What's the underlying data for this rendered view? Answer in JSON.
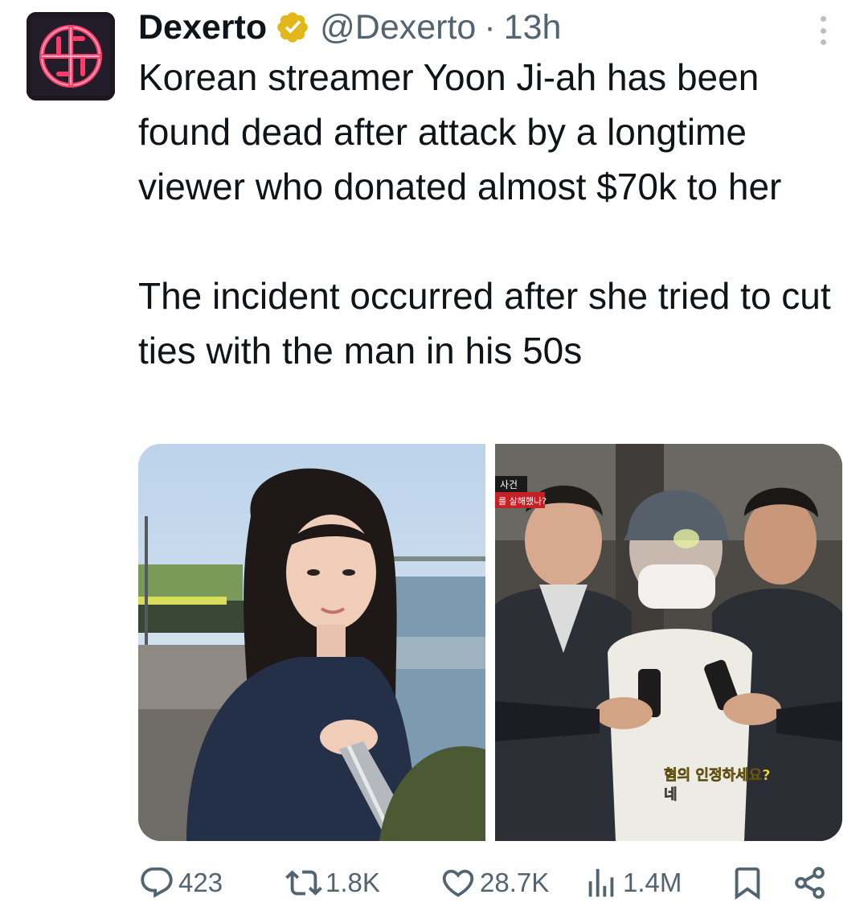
{
  "tweet": {
    "display_name": "Dexerto",
    "handle": "@Dexerto",
    "separator": "·",
    "time": "13h",
    "verified_icon": "verified-gold-badge",
    "more_icon": "vertical-dots-icon",
    "text_para1": "Korean streamer Yoon Ji-ah has been found dead after attack by a longtime viewer who donated almost $70k to her",
    "text_para2": "The incident occurred after she tried to cut ties with the man in his 50s"
  },
  "media": {
    "photo_right_overlay_tag1": "사건",
    "photo_right_overlay_tag2": "를 살해했나?",
    "photo_right_caption1": "혐의 인정하세요?",
    "photo_right_caption2": "네"
  },
  "actions": {
    "reply_count": "423",
    "repost_count": "1.8K",
    "like_count": "28.7K",
    "views_count": "1.4M"
  },
  "colors": {
    "text_primary": "#0f1419",
    "text_secondary": "#536471",
    "verified_gold": "#e2b719",
    "avatar_neon": "#ff3b6b"
  }
}
